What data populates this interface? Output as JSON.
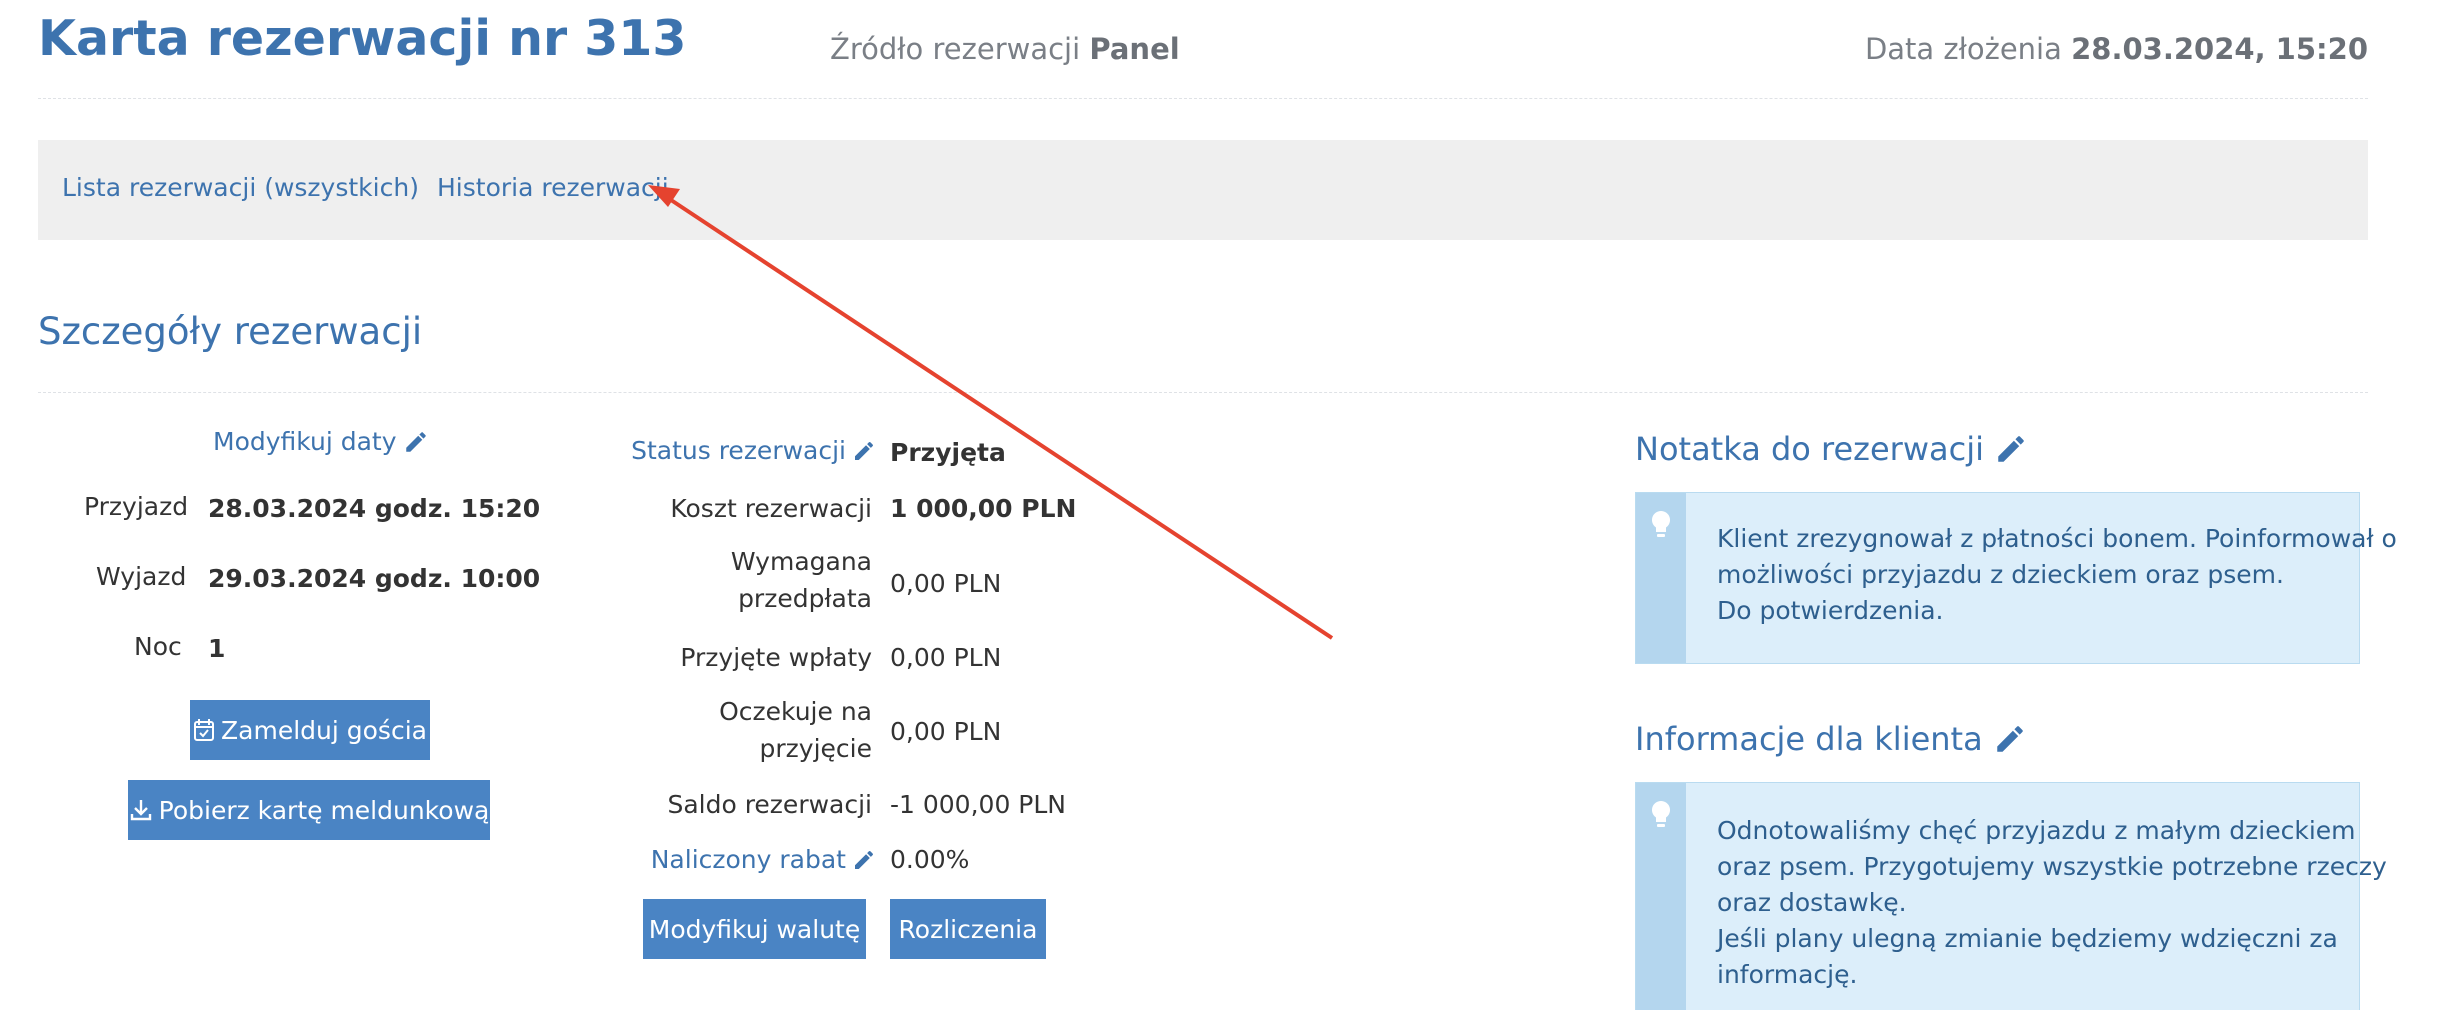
{
  "header": {
    "title": "Karta rezerwacji nr 313",
    "source_label": "Źródło rezerwacji",
    "source_value": "Panel",
    "date_label": "Data złożenia",
    "date_value": "28.03.2024, 15:20"
  },
  "nav": {
    "items": [
      {
        "label": "Lista rezerwacji (wszystkich)"
      },
      {
        "label": "Historia rezerwacji"
      }
    ]
  },
  "section": {
    "title": "Szczegóły rezerwacji"
  },
  "dates": {
    "modify_label": "Modyfikuj daty",
    "arrival_label": "Przyjazd",
    "arrival_value": "28.03.2024 godz. 15:20",
    "departure_label": "Wyjazd",
    "departure_value": "29.03.2024 godz. 10:00",
    "nights_label": "Noc",
    "nights_value": "1",
    "checkin_button": "Zamelduj gościa",
    "download_button": "Pobierz kartę meldunkową"
  },
  "booking": {
    "status_label": "Status rezerwacji",
    "status_value": "Przyjęta",
    "cost_label": "Koszt rezerwacji",
    "cost_value": "1 000,00 PLN",
    "prepayment_label_1": "Wymagana",
    "prepayment_label_2": "przedpłata",
    "prepayment_value": "0,00 PLN",
    "payments_label": "Przyjęte wpłaty",
    "payments_value": "0,00 PLN",
    "pending_label_1": "Oczekuje na",
    "pending_label_2": "przyjęcie",
    "pending_value": "0,00 PLN",
    "balance_label": "Saldo rezerwacji",
    "balance_value": "-1 000,00 PLN",
    "discount_label": "Naliczony rabat",
    "discount_value": "0.00%",
    "currency_button": "Modyfikuj walutę",
    "settlements_button": "Rozliczenia"
  },
  "note": {
    "title": "Notatka do rezerwacji",
    "lines": [
      "Klient zrezygnował z płatności bonem. Poinformował o",
      "możliwości przyjazdu z dzieckiem oraz psem.",
      "Do potwierdzenia."
    ]
  },
  "client_info": {
    "title": "Informacje dla klienta",
    "lines": [
      "Odnotowaliśmy chęć przyjazdu z małym dzieckiem",
      "oraz psem. Przygotujemy wszystkie potrzebne rzeczy",
      "oraz dostawkę.",
      "Jeśli plany ulegną zmianie będziemy wdzięczni za",
      "informację."
    ]
  },
  "colors": {
    "accent": "#3d73ae",
    "button": "#4a84c4",
    "note_bg": "#dceefa",
    "annotation_arrow": "#e5432f"
  },
  "icons": [
    "pencil-icon",
    "calendar-check-icon",
    "download-icon",
    "lightbulb-icon",
    "annotation-arrow"
  ]
}
